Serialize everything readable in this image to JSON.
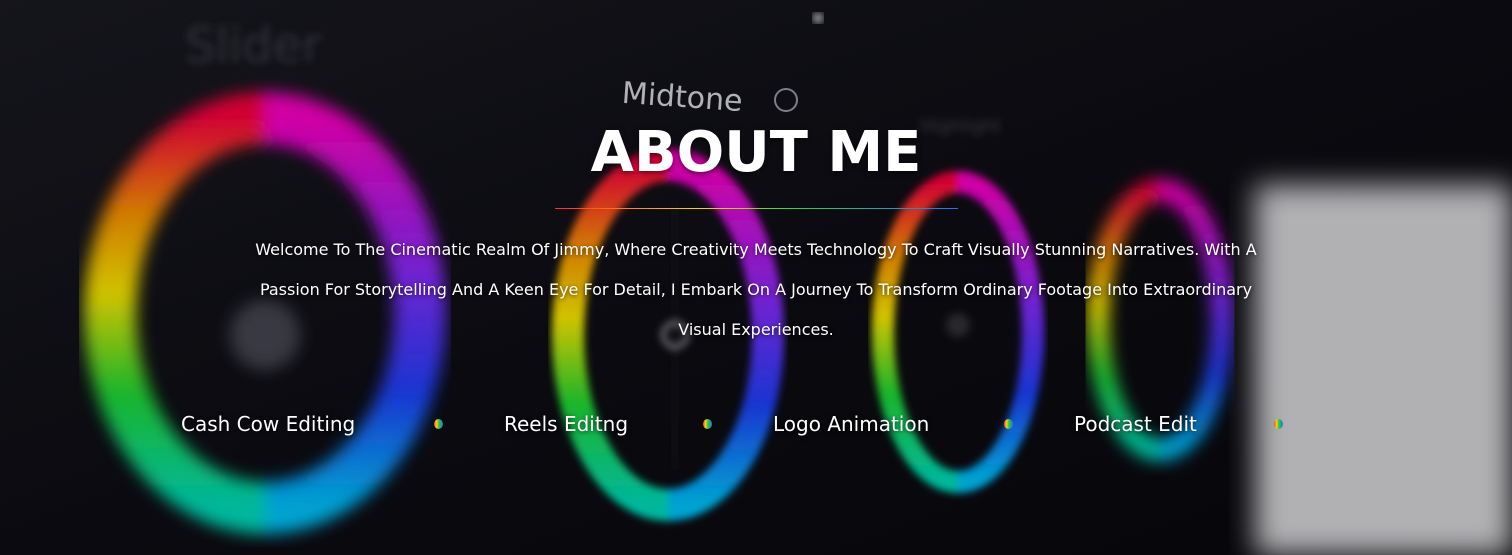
{
  "hero": {
    "background_label": "Midtone",
    "title": "ABOUT ME",
    "description": "Welcome To The Cinematic Realm Of Jimmy, Where Creativity Meets Technology To Craft Visually Stunning Narratives. With A Passion For Storytelling And A Keen Eye For Detail, I Embark On A Journey To Transform Ordinary Footage Into Extraordinary Visual Experiences."
  },
  "services": [
    {
      "label": "Cash Cow Editing"
    },
    {
      "label": "Reels Editng"
    },
    {
      "label": "Logo Animation"
    },
    {
      "label": "Podcast Edit"
    }
  ],
  "colors": {
    "text": "#ffffff",
    "background": "#0b0b10",
    "accent_gradient": [
      "#ff2a2a",
      "#ffd400",
      "#2fd24a",
      "#2a6bff"
    ]
  }
}
